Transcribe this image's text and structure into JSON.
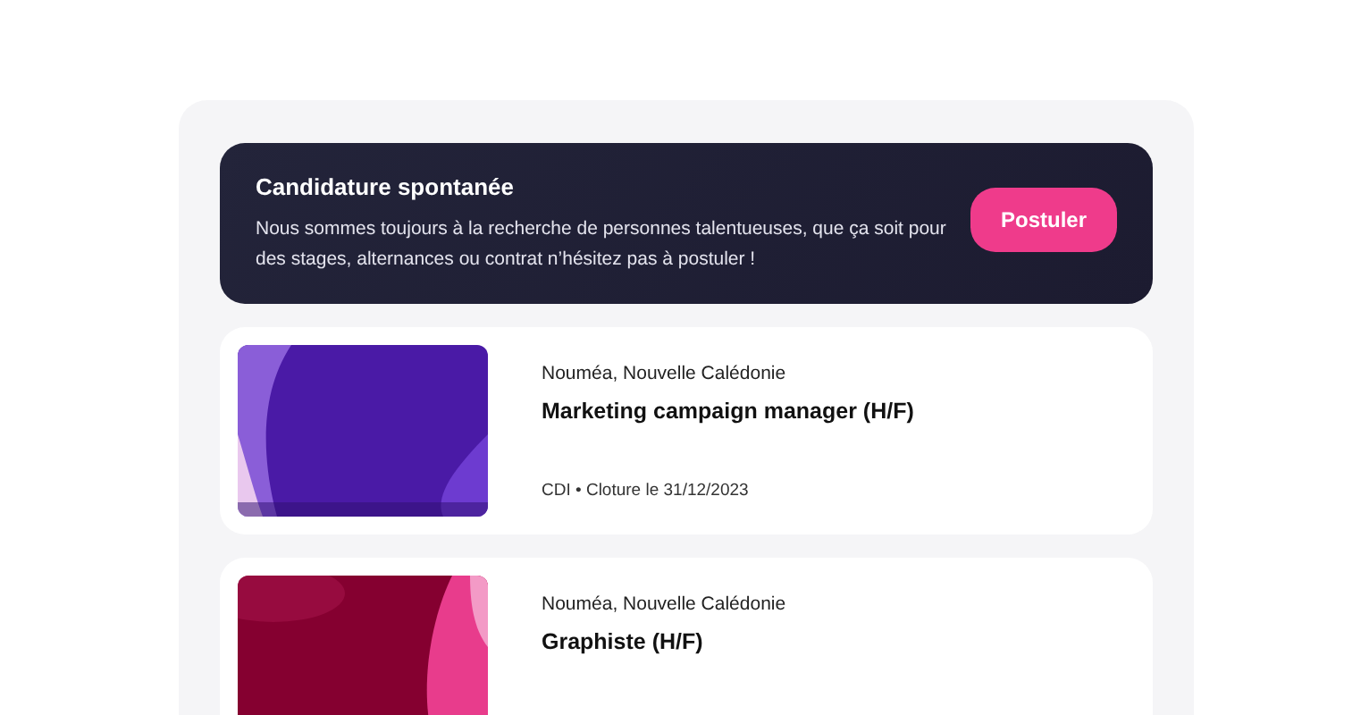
{
  "banner": {
    "title": "Candidature spontanée",
    "text": "Nous sommes toujours à la recherche de personnes talentueuses, que ça soit pour des stages, alternances ou contrat n’hésitez pas à postuler !",
    "button": "Postuler"
  },
  "jobs": [
    {
      "location": "Nouméa, Nouvelle Calédonie",
      "title": "Marketing campaign manager (H/F)",
      "meta": "CDI • Cloture le 31/12/2023"
    },
    {
      "location": "Nouméa, Nouvelle Calédonie",
      "title": "Graphiste (H/F)"
    }
  ]
}
